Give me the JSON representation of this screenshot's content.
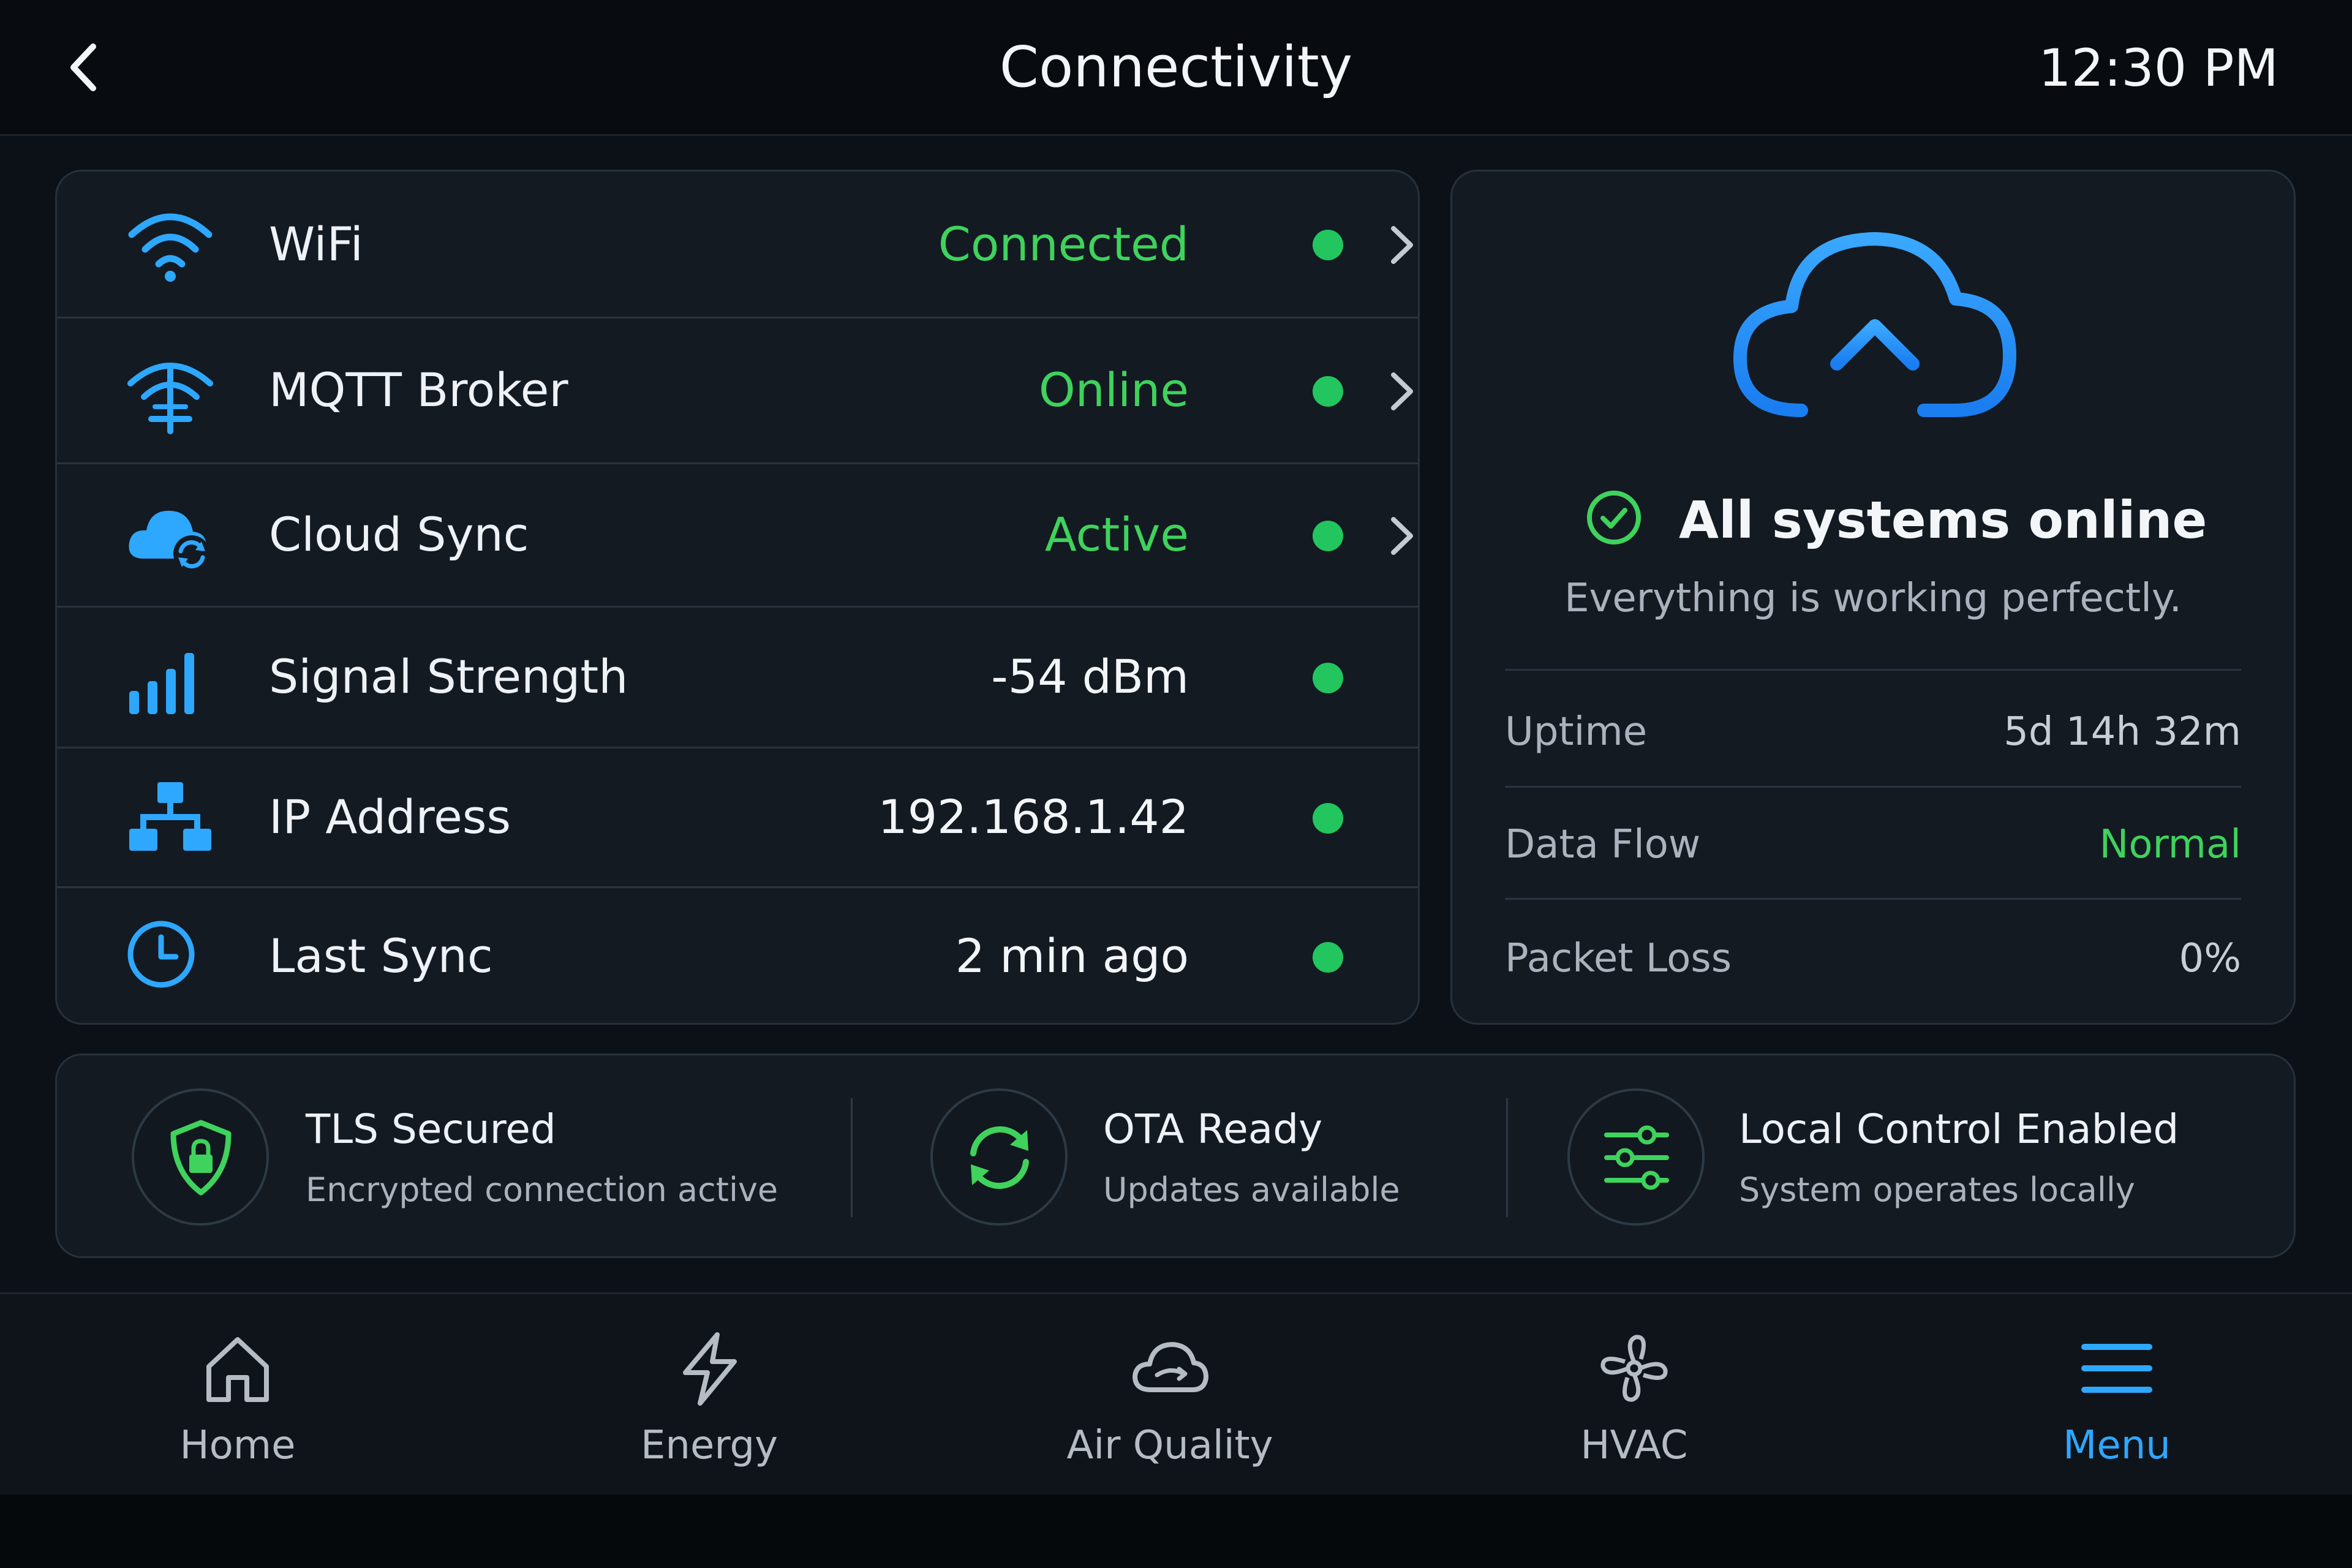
{
  "header": {
    "title": "Connectivity",
    "time": "12:30 PM"
  },
  "status_rows": [
    {
      "label": "WiFi",
      "value": "Connected",
      "icon": "wifi-icon"
    },
    {
      "label": "MQTT Broker",
      "value": "Online",
      "icon": "broadcast-tower-icon"
    },
    {
      "label": "Cloud Sync",
      "value": "Active",
      "icon": "cloud-sync-icon"
    },
    {
      "label": "Signal Strength",
      "value": "-54 dBm",
      "icon": "signal-bars-icon"
    },
    {
      "label": "IP Address",
      "value": "192.168.1.42",
      "icon": "network-icon"
    },
    {
      "label": "Last Sync",
      "value": "2 min ago",
      "icon": "clock-icon"
    }
  ],
  "summary": {
    "title": "All systems online",
    "subtitle": "Everything is working perfectly.",
    "stats": [
      {
        "label": "Uptime",
        "value": "5d 14h 32m"
      },
      {
        "label": "Data Flow",
        "value": "Normal"
      },
      {
        "label": "Packet Loss",
        "value": "0%"
      }
    ]
  },
  "features": [
    {
      "title": "TLS Secured",
      "desc": "Encrypted connection active",
      "icon": "shield-lock-icon"
    },
    {
      "title": "OTA Ready",
      "desc": "Updates available",
      "icon": "refresh-icon"
    },
    {
      "title": "Local Control Enabled",
      "desc": "System operates locally",
      "icon": "sliders-icon"
    }
  ],
  "nav": [
    {
      "label": "Home",
      "icon": "home-icon"
    },
    {
      "label": "Energy",
      "icon": "bolt-icon"
    },
    {
      "label": "Air Quality",
      "icon": "cloud-icon"
    },
    {
      "label": "HVAC",
      "icon": "fan-icon"
    },
    {
      "label": "Menu",
      "icon": "menu-icon",
      "active": true
    }
  ],
  "colors": {
    "accent_blue": "#2ea7ff",
    "status_green": "#3fd25c",
    "status_dot": "#22c55e",
    "background": "#0c1117",
    "card": "#131a22"
  }
}
